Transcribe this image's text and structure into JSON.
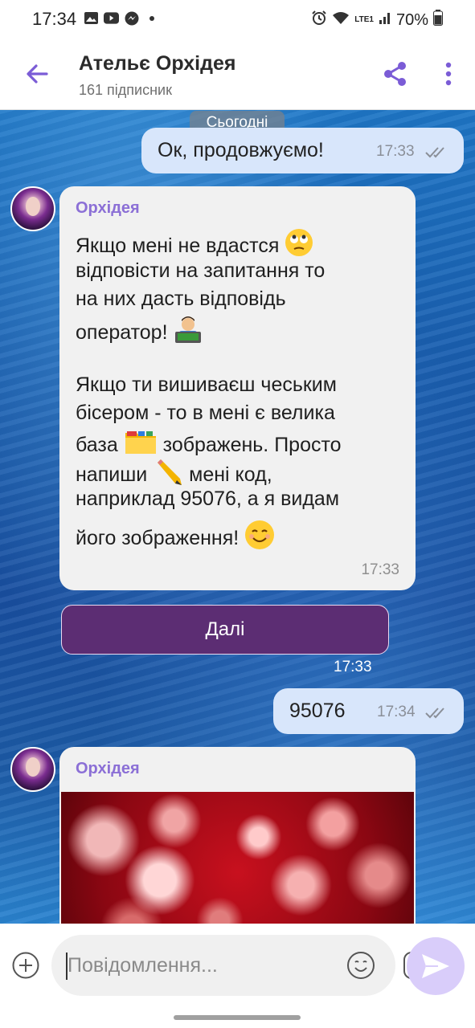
{
  "status_bar": {
    "time": "17:34",
    "network": "LTE1",
    "battery": "70%",
    "icons": [
      "image-icon",
      "youtube-icon",
      "messenger-icon",
      "dot-icon",
      "alarm-icon",
      "wifi-icon",
      "signal-icon",
      "battery-icon"
    ]
  },
  "header": {
    "title": "Ательє Орхідея",
    "subtitle": "161 підписник",
    "icons": [
      "back-arrow-icon",
      "share-icon",
      "more-vertical-icon"
    ],
    "accent_color": "#7b5cd6"
  },
  "chat": {
    "date_label": "Сьогодні",
    "messages": [
      {
        "direction": "outgoing",
        "text": "Ок, продовжуємо!",
        "time": "17:33",
        "status_icon": "double-check-icon"
      },
      {
        "direction": "incoming",
        "sender": "Орхідея",
        "lines": [
          "Якщо мені не вдастся",
          "відповісти на запитання то",
          "на них дасть відповідь",
          "оператор!",
          "",
          "Якщо ти вишиваєш чеським",
          "бісером - то в мені є велика",
          "база",
          "зображень. Просто",
          "напиши",
          "мені код,",
          "наприклад 95076, а я видам",
          "його зображення!"
        ],
        "emojis": [
          "rolling-eyes-emoji",
          "technologist-emoji",
          "folder-emoji",
          "pencil-emoji",
          "smiling-face-emoji"
        ],
        "time": "17:33"
      },
      {
        "direction": "bot-button",
        "label": "Далі",
        "time": "17:33"
      },
      {
        "direction": "outgoing",
        "text": "95076",
        "time": "17:34",
        "status_icon": "double-check-icon"
      },
      {
        "direction": "incoming",
        "sender": "Орхідея",
        "media": "red-beads-image"
      }
    ]
  },
  "composer": {
    "placeholder": "Повідомлення...",
    "icons": [
      "add-circle-icon",
      "emoji-icon",
      "sticker-icon",
      "send-icon"
    ]
  },
  "colors": {
    "outgoing_bubble": "#d8e6fb",
    "incoming_bubble": "#f1f1f1",
    "button": "#5c2d73",
    "sender_name": "#8b6fd6",
    "send_button": "#d9cdfa"
  }
}
